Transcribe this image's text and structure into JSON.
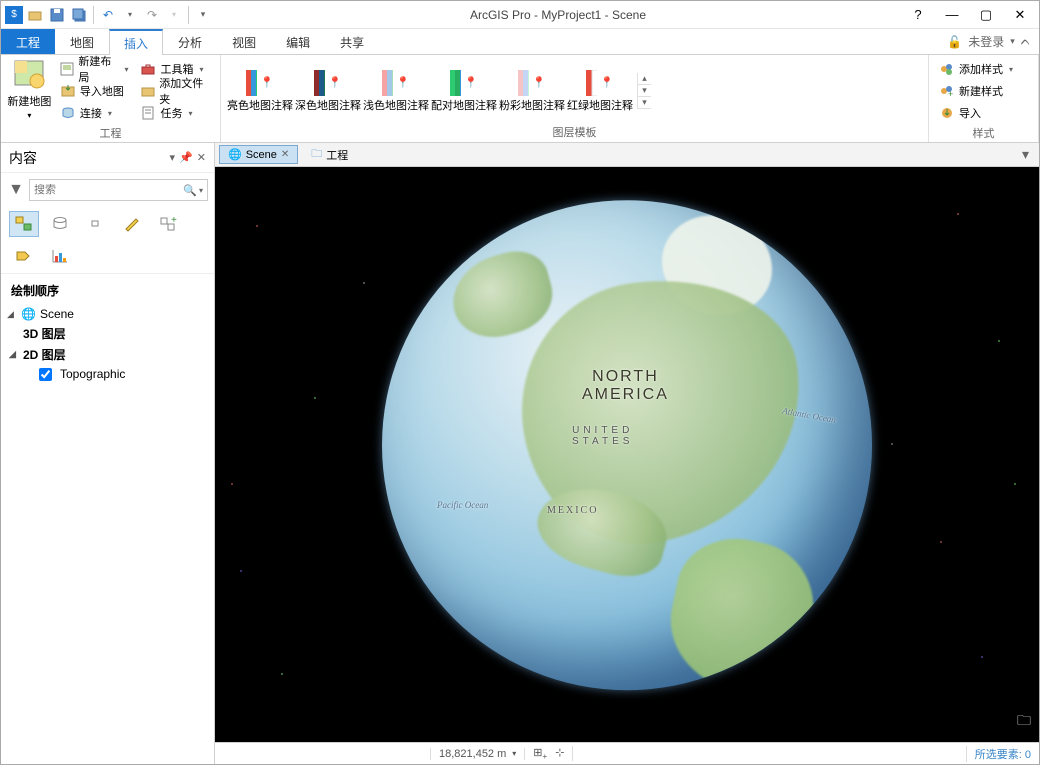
{
  "title": "ArcGIS Pro - MyProject1 - Scene",
  "login": {
    "not_logged": "未登录"
  },
  "tabs": {
    "file": "工程",
    "map": "地图",
    "insert": "插入",
    "analysis": "分析",
    "view": "视图",
    "edit": "编辑",
    "share": "共享"
  },
  "ribbon": {
    "group1": {
      "new_map": "新建地图",
      "new_layout": "新建布局",
      "import_map": "导入地图",
      "connect": "连接",
      "toolbox": "工具箱",
      "add_folder": "添加文件夹",
      "tasks": "任务",
      "label": "工程"
    },
    "gallery": {
      "items": [
        "亮色地图注释",
        "深色地图注释",
        "浅色地图注释",
        "配对地图注释",
        "粉彩地图注释",
        "红绿地图注释"
      ],
      "label": "图层模板"
    },
    "styles": {
      "add": "添加样式",
      "new": "新建样式",
      "import": "导入",
      "label": "样式"
    }
  },
  "contents": {
    "title": "内容",
    "search_placeholder": "搜索",
    "draw_order": "绘制顺序",
    "scene": "Scene",
    "layers3d": "3D 图层",
    "layers2d": "2D 图层",
    "topo": "Topographic"
  },
  "view_tabs": {
    "scene": "Scene",
    "project": "工程"
  },
  "globe": {
    "na": "NORTH",
    "na2": "AMERICA",
    "us": "UNITED",
    "us2": "STATES",
    "mexico": "MEXICO",
    "pacific": "Pacific Ocean",
    "atlantic": "Atlantic Ocean"
  },
  "status": {
    "scale": "18,821,452 m",
    "selected": "所选要素: 0"
  }
}
